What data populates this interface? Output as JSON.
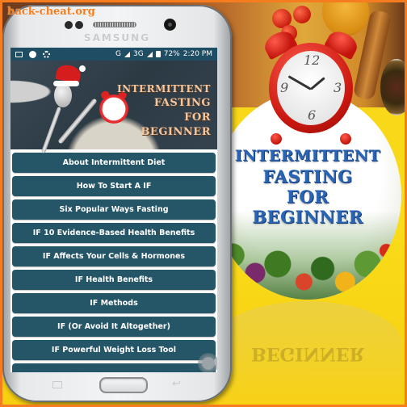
{
  "watermark": "hack-cheat.org",
  "device": {
    "brand": "SAMSUNG"
  },
  "status_bar": {
    "left_icons": [
      "image-icon",
      "chrome-icon",
      "sync-icon"
    ],
    "network_1": "G",
    "network_2": "3G",
    "network_2_sup": "3G",
    "battery": "72%",
    "time": "2:20 PM"
  },
  "banner": {
    "title_lines": [
      "INTERMITTENT",
      "FASTING",
      "FOR",
      "BEGINNER"
    ]
  },
  "menu": {
    "items": [
      {
        "label": "About Intermittent Diet"
      },
      {
        "label": "How To Start A IF"
      },
      {
        "label": "Six Popular Ways Fasting"
      },
      {
        "label": "IF 10 Evidence-Based Health Benefits"
      },
      {
        "label": "IF Affects Your Cells & Hormones"
      },
      {
        "label": "IF Health Benefits"
      },
      {
        "label": "IF Methods"
      },
      {
        "label": "IF (Or Avoid It Altogether)"
      },
      {
        "label": "IF Powerful Weight Loss Tool"
      }
    ]
  },
  "promo": {
    "title_lines": [
      "INTERMITTENT",
      "FASTING",
      "FOR",
      "BEGINNER"
    ],
    "reflection_text": "BEGINNER",
    "clock_numbers": [
      "12",
      "3",
      "6",
      "9"
    ]
  },
  "colors": {
    "outer_border": "#f57c1f",
    "background_yellow": "#f9dc1a",
    "menu_button": "#245668",
    "status_bar": "#1f4d63",
    "banner_text": "#f4c7a0",
    "promo_title": "#2a64b4"
  }
}
